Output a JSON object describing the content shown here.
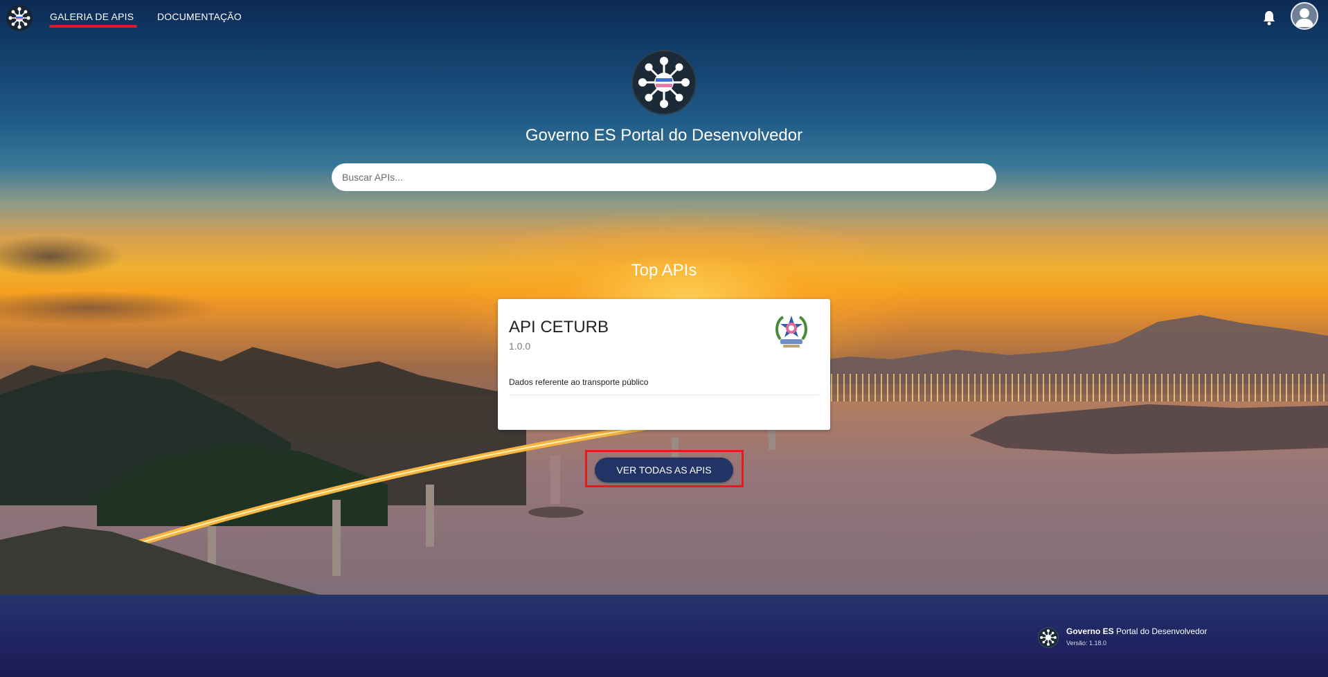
{
  "nav": {
    "gallery_label": "GALERIA DE APIS",
    "docs_label": "DOCUMENTAÇÃO",
    "accent_color": "#e21b23"
  },
  "icons": {
    "brand": "network-logo-icon",
    "notifications": "bell-icon",
    "profile": "user-avatar-icon"
  },
  "hero": {
    "title": "Governo ES Portal do Desenvolvedor",
    "search_placeholder": "Buscar APIs...",
    "search_value": ""
  },
  "top_apis": {
    "heading": "Top APIs",
    "cards": [
      {
        "name": "API CETURB",
        "version": "1.0.0",
        "description": "Dados referente ao transporte público",
        "emblem": "es-state-coat-of-arms"
      }
    ],
    "view_all_label": "VER TODAS AS APIS",
    "button_color": "#223365"
  },
  "footer": {
    "brand_bold": "Governo ES",
    "brand_rest": " Portal do Desenvolvedor",
    "version": "Versão: 1.18.0"
  }
}
